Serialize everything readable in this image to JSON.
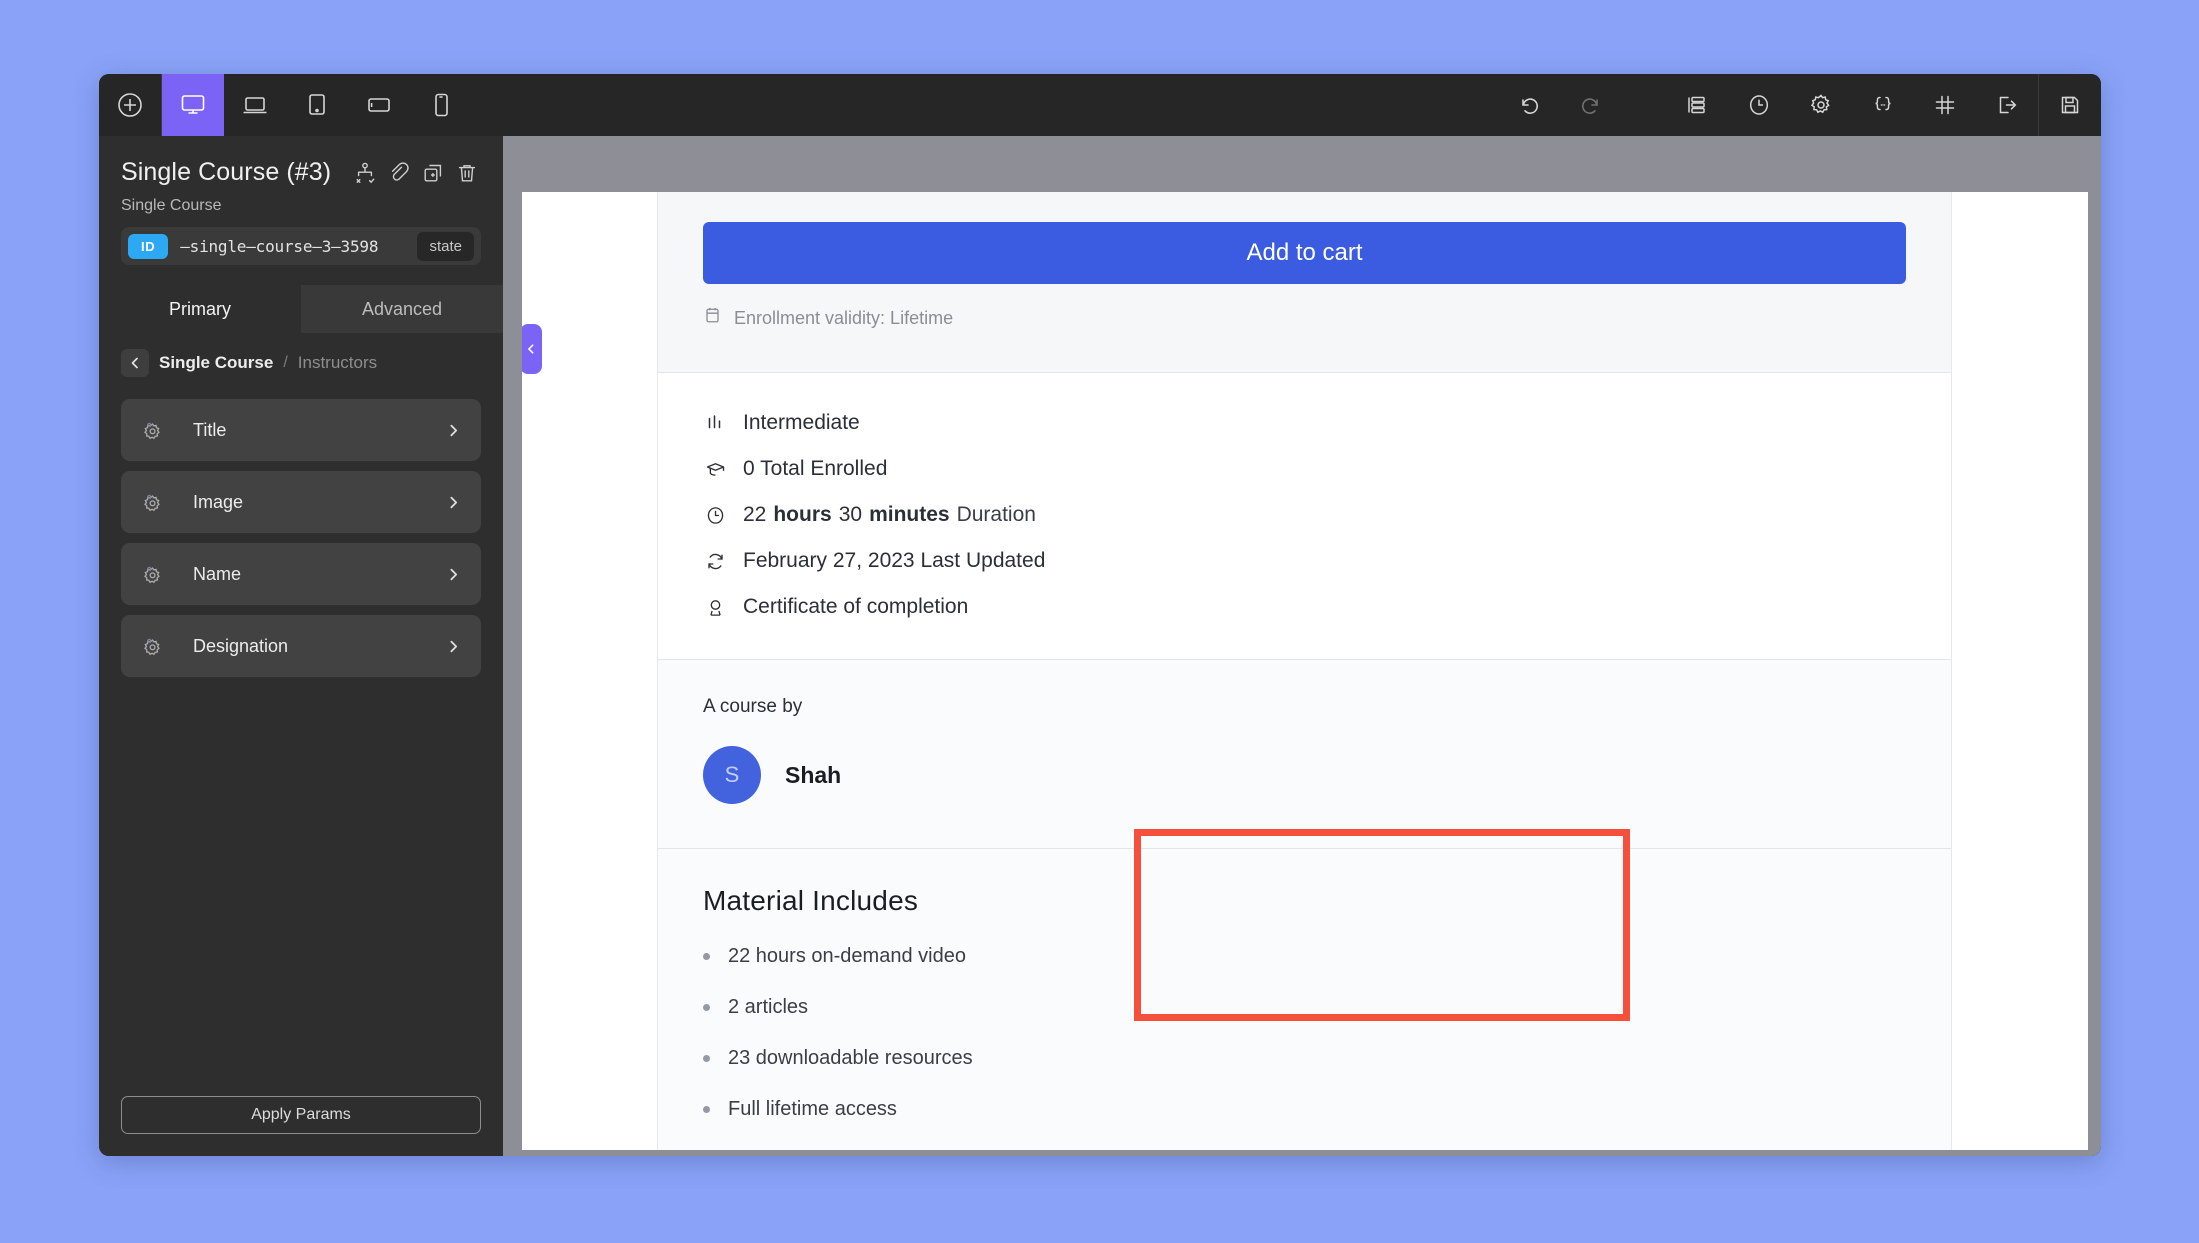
{
  "toolbar": {
    "left_items": [
      {
        "name": "add-button",
        "icon": "plus-circle-icon",
        "active": false
      },
      {
        "name": "viewport-desktop",
        "icon": "desktop-icon",
        "active": true
      },
      {
        "name": "viewport-laptop",
        "icon": "laptop-icon",
        "active": false
      },
      {
        "name": "viewport-tablet-portrait",
        "icon": "tablet-portrait-icon",
        "active": false
      },
      {
        "name": "viewport-tablet-landscape",
        "icon": "tablet-landscape-icon",
        "active": false
      },
      {
        "name": "viewport-mobile",
        "icon": "mobile-icon",
        "active": false
      }
    ],
    "right_items": [
      {
        "name": "undo-button",
        "icon": "undo-icon",
        "disabled": false
      },
      {
        "name": "redo-button",
        "icon": "redo-icon",
        "disabled": true
      },
      {
        "name": "layers-button",
        "icon": "layers-icon",
        "disabled": false
      },
      {
        "name": "history-button",
        "icon": "clock-icon",
        "disabled": false
      },
      {
        "name": "settings-button",
        "icon": "gear-icon",
        "disabled": false
      },
      {
        "name": "code-button",
        "icon": "curly-braces-icon",
        "disabled": false
      },
      {
        "name": "grid-button",
        "icon": "hash-grid-icon",
        "disabled": false
      },
      {
        "name": "exit-button",
        "icon": "export-icon",
        "disabled": false
      },
      {
        "name": "save-button",
        "icon": "floppy-save-icon",
        "disabled": false
      }
    ]
  },
  "panel": {
    "title": "Single Course (#3)",
    "subtitle": "Single Course",
    "header_icons": [
      {
        "name": "condition-icon"
      },
      {
        "name": "link-icon"
      },
      {
        "name": "duplicate-icon"
      },
      {
        "name": "trash-icon"
      }
    ],
    "id_badge": "ID",
    "id_value": "–single–course–3–3598",
    "state_chip": "state",
    "tabs": [
      {
        "label": "Primary",
        "active": true
      },
      {
        "label": "Advanced",
        "active": false
      }
    ],
    "breadcrumb": {
      "back": "‹",
      "current": "Single Course",
      "separator": "/",
      "next": "Instructors"
    },
    "items": [
      {
        "label": "Title",
        "icon": "gear-icon",
        "chevron": "›"
      },
      {
        "label": "Image",
        "icon": "gear-icon",
        "chevron": "›"
      },
      {
        "label": "Name",
        "icon": "gear-icon",
        "chevron": "›"
      },
      {
        "label": "Designation",
        "icon": "gear-icon",
        "chevron": "›"
      }
    ],
    "apply_button": "Apply Params"
  },
  "canvas": {
    "collapse_handle": "‹",
    "add_to_cart": "Add to cart",
    "enrollment_validity": "Enrollment validity: Lifetime",
    "meta": [
      {
        "icon": "level-bars-icon",
        "text": "Intermediate"
      },
      {
        "icon": "graduation-cap-icon",
        "text": "0 Total Enrolled"
      },
      {
        "icon": "clock-icon",
        "text": "22 hours  30 minutes  Duration",
        "parts": [
          {
            "value": "22",
            "strong": false
          },
          {
            "value": "hours",
            "strong": true
          },
          {
            "value": "30",
            "strong": false
          },
          {
            "value": "minutes",
            "strong": true
          },
          {
            "value": "Duration",
            "strong": false
          }
        ]
      },
      {
        "icon": "refresh-icon",
        "text": "February 27, 2023 Last Updated"
      },
      {
        "icon": "award-icon",
        "text": "Certificate of completion"
      }
    ],
    "instructor_section": {
      "label": "A course by",
      "avatar_initial": "S",
      "name": "Shah"
    },
    "material": {
      "title": "Material Includes",
      "items": [
        "22 hours on-demand video",
        "2 articles",
        "23 downloadable resources",
        "Full lifetime access"
      ]
    }
  },
  "colors": {
    "page_background": "#8aa3f8",
    "accent_purple": "#7b63f5",
    "id_badge_blue": "#2ca9f2",
    "cta_blue": "#3b5ce0",
    "avatar_blue": "#4263dd",
    "highlight_red": "#f4503c",
    "panel_dark": "#2e2e2e",
    "toolbar_dark": "#262626"
  }
}
